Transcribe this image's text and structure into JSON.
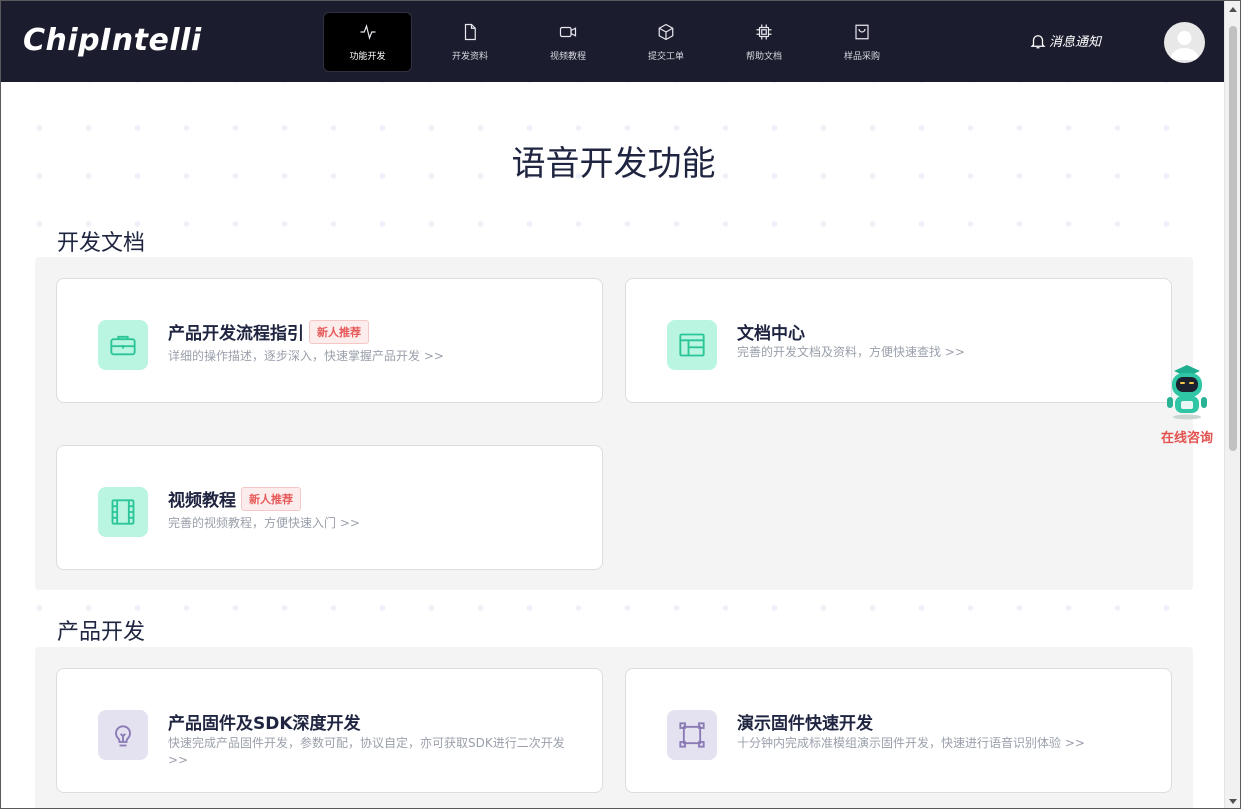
{
  "header": {
    "logo": "ChipIntelli",
    "nav": [
      {
        "label": "功能开发",
        "icon": "activity-icon",
        "active": true
      },
      {
        "label": "开发资料",
        "icon": "file-icon",
        "active": false
      },
      {
        "label": "视频教程",
        "icon": "video-icon",
        "active": false
      },
      {
        "label": "提交工单",
        "icon": "cube-icon",
        "active": false
      },
      {
        "label": "帮助文档",
        "icon": "chip-icon",
        "active": false
      },
      {
        "label": "样品采购",
        "icon": "shopping-bag-icon",
        "active": false
      }
    ],
    "notify_label": "消息通知"
  },
  "main": {
    "title": "语音开发功能",
    "sections": [
      {
        "title": "开发文档",
        "cards": [
          {
            "title": "产品开发流程指引",
            "badge": "新人推荐",
            "desc": "详细的操作描述，逐步深入，快速掌握产品开发 >>",
            "icon": "toolbox-icon"
          },
          {
            "title": "文档中心",
            "badge": "",
            "desc": "完善的开发文档及资料，方便快速查找 >>",
            "icon": "layout-icon"
          },
          {
            "title": "视频教程",
            "badge": "新人推荐",
            "desc": "完善的视频教程，方便快速入门 >>",
            "icon": "film-icon"
          }
        ]
      },
      {
        "title": "产品开发",
        "cards": [
          {
            "title": "产品固件及SDK深度开发",
            "badge": "",
            "desc": "快速完成产品固件开发，参数可配，协议自定，亦可获取SDK进行二次开发 >>",
            "icon": "lightbulb-icon"
          },
          {
            "title": "演示固件快速开发",
            "badge": "",
            "desc": "十分钟内完成标准模组演示固件开发，快速进行语音识别体验 >>",
            "icon": "frame-icon"
          }
        ]
      }
    ]
  },
  "consult": {
    "label": "在线咨询"
  },
  "colors": {
    "header_bg": "#1b1c2e",
    "accent_green": "#2cc598",
    "badge_red": "#e65a5a"
  }
}
